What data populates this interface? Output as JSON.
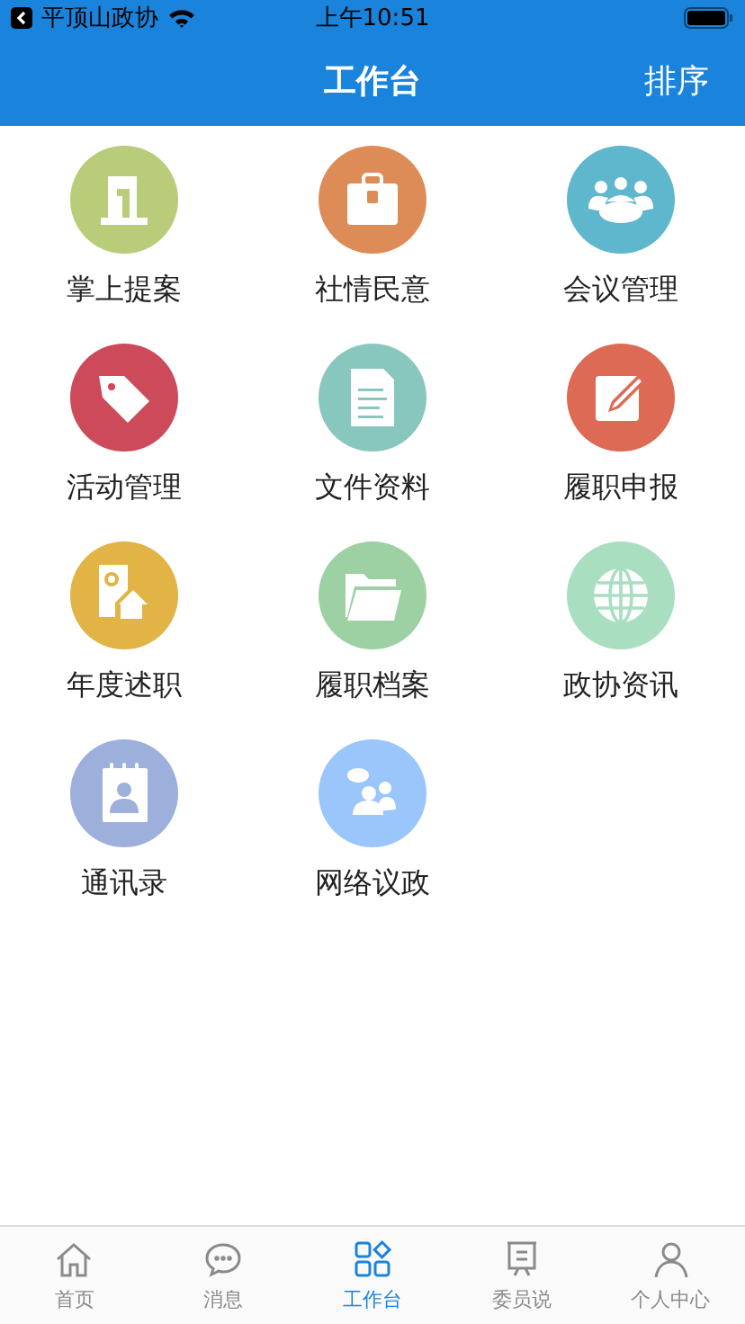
{
  "status_bar": {
    "back_label": "平顶山政协",
    "time": "上午10:51"
  },
  "nav": {
    "title": "工作台",
    "action": "排序"
  },
  "items": [
    {
      "label": "掌上提案",
      "color": "#b8cc7a",
      "kind": "podium"
    },
    {
      "label": "社情民意",
      "color": "#de8c57",
      "kind": "briefcase"
    },
    {
      "label": "会议管理",
      "color": "#5eb7cc",
      "kind": "people"
    },
    {
      "label": "活动管理",
      "color": "#cc4a5a",
      "kind": "tag"
    },
    {
      "label": "文件资料",
      "color": "#88c7bd",
      "kind": "document"
    },
    {
      "label": "履职申报",
      "color": "#dc6a54",
      "kind": "edit"
    },
    {
      "label": "年度述职",
      "color": "#e2b445",
      "kind": "report"
    },
    {
      "label": "履职档案",
      "color": "#9dd0a2",
      "kind": "folder"
    },
    {
      "label": "政协资讯",
      "color": "#a9dfc0",
      "kind": "globe"
    },
    {
      "label": "通讯录",
      "color": "#9db0dc",
      "kind": "contacts"
    },
    {
      "label": "网络议政",
      "color": "#9ac6fb",
      "kind": "chat"
    }
  ],
  "tabs": [
    {
      "label": "首页",
      "kind": "home",
      "selected": false
    },
    {
      "label": "消息",
      "kind": "message",
      "selected": false
    },
    {
      "label": "工作台",
      "kind": "grid",
      "selected": true
    },
    {
      "label": "委员说",
      "kind": "board",
      "selected": false
    },
    {
      "label": "个人中心",
      "kind": "person",
      "selected": false
    }
  ]
}
